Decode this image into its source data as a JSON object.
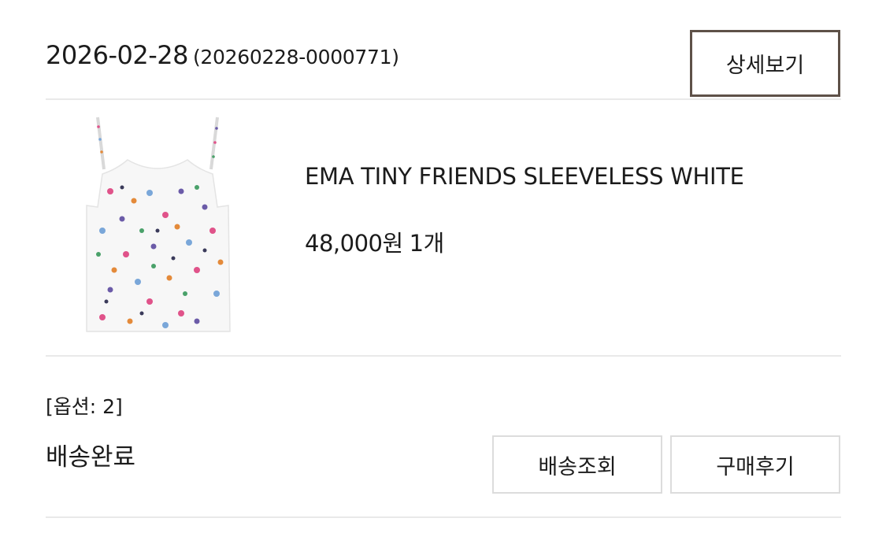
{
  "order": {
    "date": "2026-02-28",
    "number": "(20260228-0000771)",
    "detail_button_label": "상세보기"
  },
  "product": {
    "image_alt": "sleeveless-top-product-photo",
    "name": "EMA TINY FRIENDS SLEEVELESS WHITE",
    "price": "48,000원",
    "quantity": "1개"
  },
  "option": {
    "text": "[옵션: 2]"
  },
  "status": {
    "text": "배송완료"
  },
  "actions": {
    "tracking_label": "배송조회",
    "review_label": "구매후기"
  },
  "colors": {
    "detail_button_border": "#5e5148",
    "divider": "#e9e9e9",
    "action_button_border": "#dcdcdc",
    "text": "#1b1b1b"
  }
}
